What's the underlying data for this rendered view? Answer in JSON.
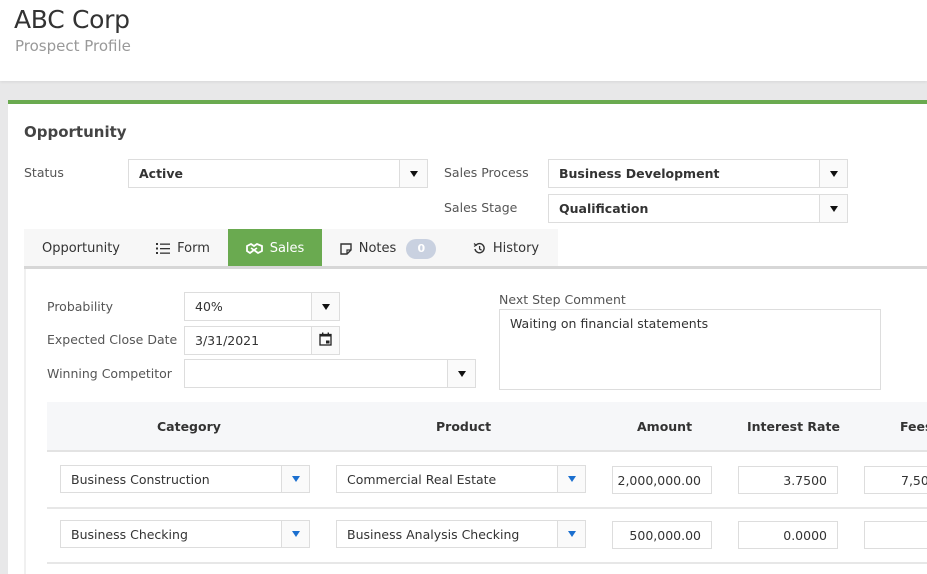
{
  "header": {
    "title": "ABC Corp",
    "subtitle": "Prospect Profile"
  },
  "colors": {
    "accent": "#6aaa50",
    "badge": "#c9d1e0",
    "dropdown_caret_blue": "#1b6fcf"
  },
  "opportunity": {
    "section_title": "Opportunity",
    "status": {
      "label": "Status",
      "value": "Active"
    },
    "sales_process": {
      "label": "Sales Process",
      "value": "Business Development"
    },
    "sales_stage": {
      "label": "Sales Stage",
      "value": "Qualification"
    }
  },
  "tabs": [
    {
      "label": "Opportunity",
      "icon": "none",
      "active": false
    },
    {
      "label": "Form",
      "icon": "list-icon",
      "active": false
    },
    {
      "label": "Sales",
      "icon": "handshake-icon",
      "active": true
    },
    {
      "label": "Notes",
      "icon": "note-icon",
      "active": false,
      "badge": "0"
    },
    {
      "label": "History",
      "icon": "history-icon",
      "active": false
    }
  ],
  "sales": {
    "probability": {
      "label": "Probability",
      "value": "40%"
    },
    "expected_close_date": {
      "label": "Expected Close Date",
      "value": "3/31/2021"
    },
    "winning_competitor": {
      "label": "Winning Competitor",
      "value": ""
    },
    "next_step_comment": {
      "label": "Next Step Comment",
      "value": "Waiting on financial statements"
    }
  },
  "products_table": {
    "columns": [
      "Category",
      "Product",
      "Amount",
      "Interest Rate",
      "Fees"
    ],
    "rows": [
      {
        "category": "Business Construction",
        "product": "Commercial Real Estate",
        "amount": "2,000,000.00",
        "interest_rate": "3.7500",
        "fees": "7,50"
      },
      {
        "category": "Business Checking",
        "product": "Business Analysis Checking",
        "amount": "500,000.00",
        "interest_rate": "0.0000",
        "fees": ""
      }
    ]
  }
}
